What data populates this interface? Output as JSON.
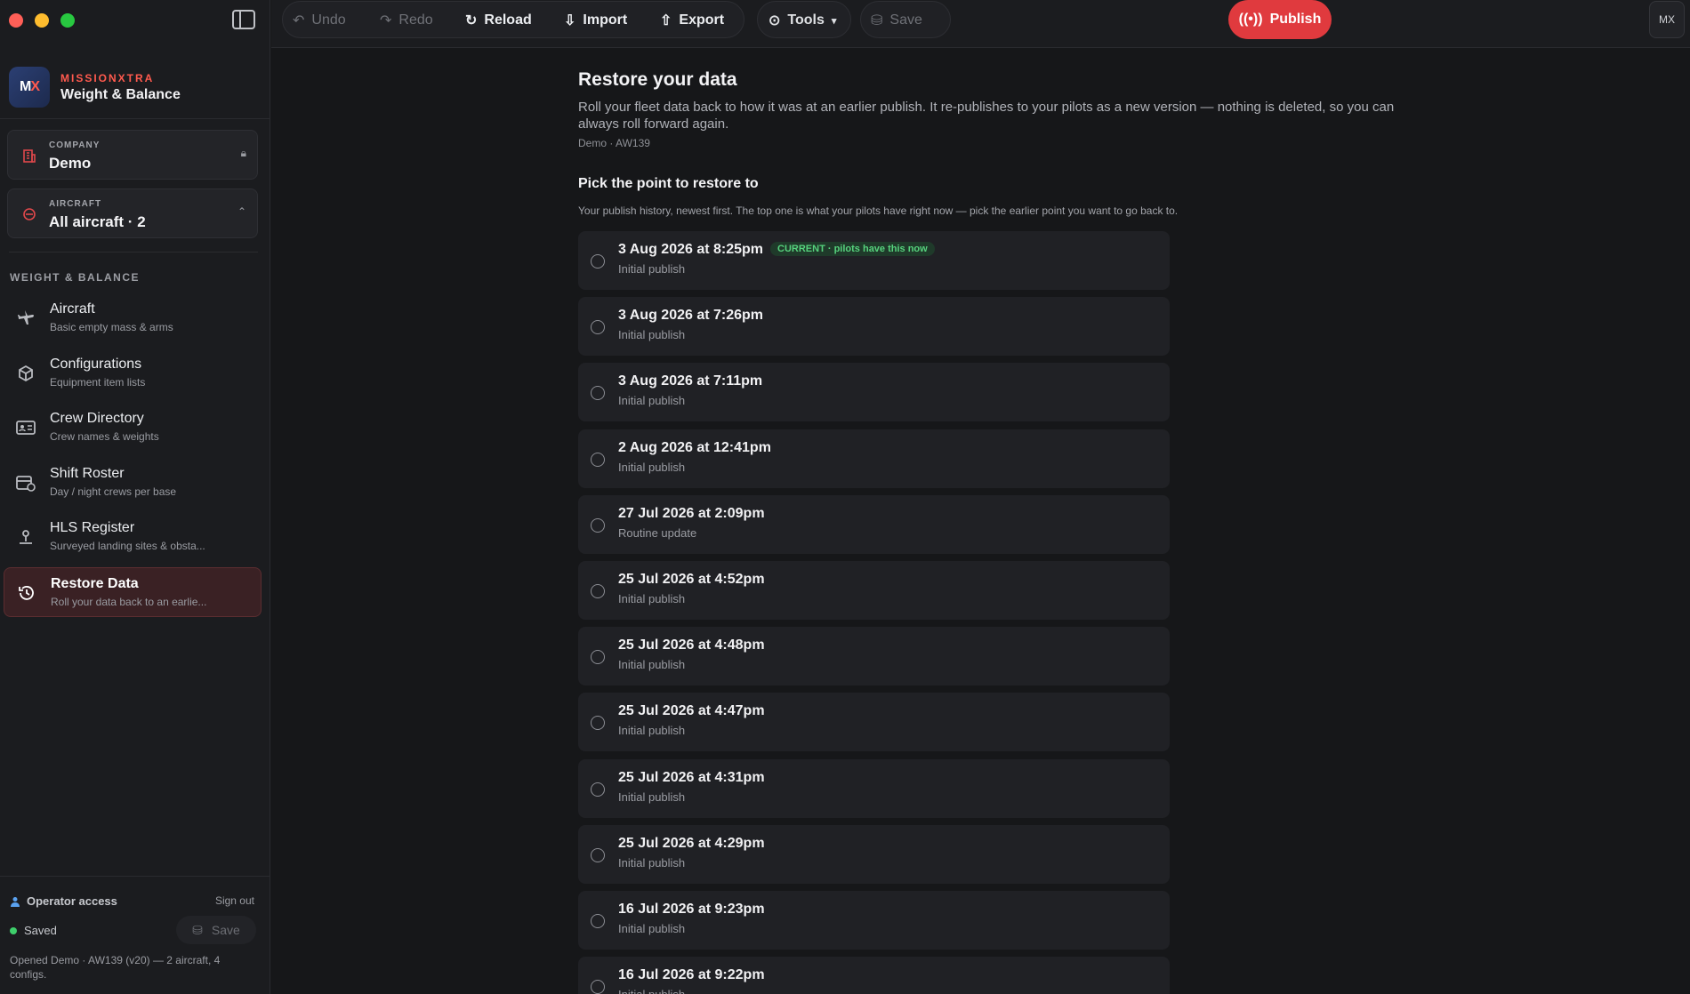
{
  "brand": {
    "kicker": "MISSIONXTRA",
    "name": "Weight & Balance",
    "logo_text": "MX"
  },
  "company": {
    "label": "COMPANY",
    "value": "Demo"
  },
  "aircraft_picker": {
    "label": "AIRCRAFT",
    "value": "All aircraft · 2"
  },
  "section_label": "WEIGHT & BALANCE",
  "nav": [
    {
      "title": "Aircraft",
      "subtitle": "Basic empty mass & arms",
      "icon": "plane-icon"
    },
    {
      "title": "Configurations",
      "subtitle": "Equipment item lists",
      "icon": "box-icon"
    },
    {
      "title": "Crew Directory",
      "subtitle": "Crew names & weights",
      "icon": "id-card-icon"
    },
    {
      "title": "Shift Roster",
      "subtitle": "Day / night crews per base",
      "icon": "calendar-icon"
    },
    {
      "title": "HLS Register",
      "subtitle": "Surveyed landing sites & obsta...",
      "icon": "landing-site-icon"
    },
    {
      "title": "Restore Data",
      "subtitle": "Roll your data back to an earlie...",
      "icon": "history-icon",
      "active": true
    }
  ],
  "footer": {
    "access": "Operator access",
    "signout": "Sign out",
    "status": "Saved",
    "save": "Save",
    "note": "Opened Demo · AW139 (v20) — 2 aircraft, 4 configs."
  },
  "toolbar": {
    "undo": "Undo",
    "redo": "Redo",
    "reload": "Reload",
    "import": "Import",
    "export": "Export",
    "tools": "Tools",
    "save": "Save",
    "publish": "Publish",
    "avatar": "MX"
  },
  "colors": {
    "accent": "#e03a3e",
    "badge_green": "#56d27d",
    "background": "#161719"
  },
  "main": {
    "title": "Restore your data",
    "intro": "Roll your fleet data back to how it was at an earlier publish. It re-publishes to your pilots as a new version — nothing is deleted, so you can always roll forward again.",
    "crumb": "Demo · AW139",
    "pick_title": "Pick the point to restore to",
    "pick_sub": "Your publish history, newest first. The top one is what your pilots have right now — pick the earlier point you want to go back to.",
    "current_badge": "CURRENT · pilots have this now",
    "history": [
      {
        "date": "3 Aug 2026 at 8:25pm",
        "note": "Initial publish",
        "current": true
      },
      {
        "date": "3 Aug 2026 at 7:26pm",
        "note": "Initial publish"
      },
      {
        "date": "3 Aug 2026 at 7:11pm",
        "note": "Initial publish"
      },
      {
        "date": "2 Aug 2026 at 12:41pm",
        "note": "Initial publish"
      },
      {
        "date": "27 Jul 2026 at 2:09pm",
        "note": "Routine update"
      },
      {
        "date": "25 Jul 2026 at 4:52pm",
        "note": "Initial publish"
      },
      {
        "date": "25 Jul 2026 at 4:48pm",
        "note": "Initial publish"
      },
      {
        "date": "25 Jul 2026 at 4:47pm",
        "note": "Initial publish"
      },
      {
        "date": "25 Jul 2026 at 4:31pm",
        "note": "Initial publish"
      },
      {
        "date": "25 Jul 2026 at 4:29pm",
        "note": "Initial publish"
      },
      {
        "date": "16 Jul 2026 at 9:23pm",
        "note": "Initial publish"
      },
      {
        "date": "16 Jul 2026 at 9:22pm",
        "note": "Initial publish"
      }
    ]
  }
}
